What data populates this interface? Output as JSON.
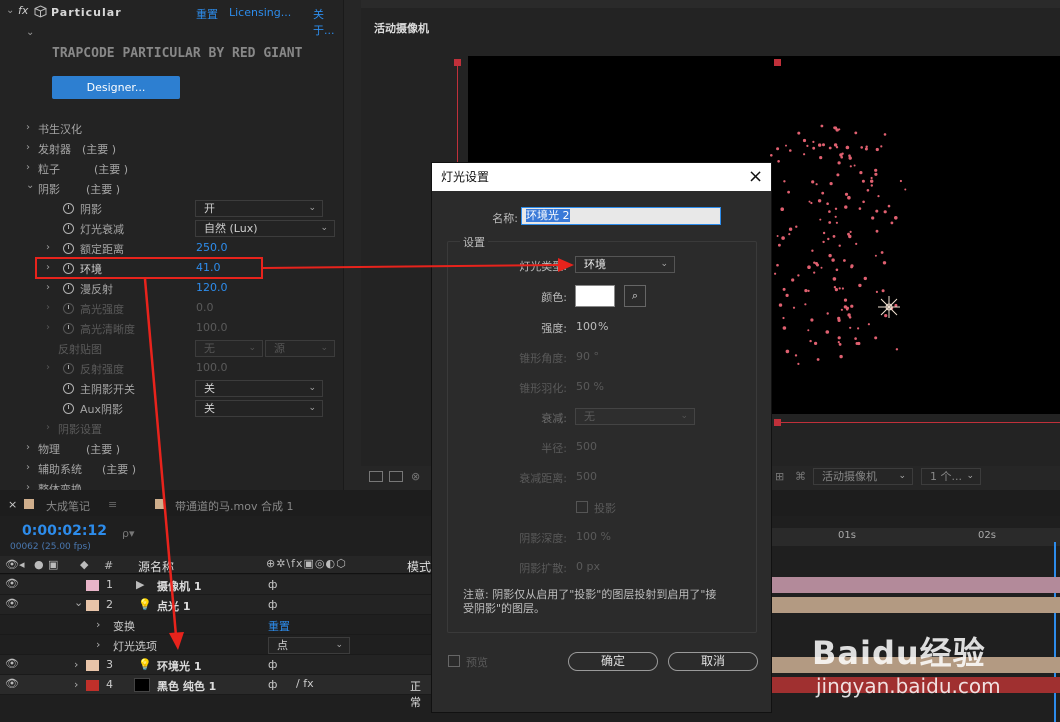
{
  "effects": {
    "fx_name": "Particular",
    "reset": "重置",
    "licensing": "Licensing...",
    "about": "关于...",
    "brand": "TRAPCODE PARTICULAR BY RED GIANT",
    "designer_btn": "Designer...",
    "groups": [
      {
        "label": "书生汉化",
        "tag": ""
      },
      {
        "label": "发射器",
        "tag": "(主要 )"
      },
      {
        "label": "粒子",
        "tag": "(主要 )"
      },
      {
        "label": "阴影",
        "tag": "(主要 )"
      }
    ],
    "params": {
      "shadow": {
        "label": "阴影",
        "value": "开"
      },
      "light_falloff": {
        "label": "灯光衰减",
        "value": "自然 (Lux)"
      },
      "nominal_distance": {
        "label": "额定距离",
        "value": "250.0"
      },
      "ambient": {
        "label": "环境",
        "value": "41.0"
      },
      "diffuse": {
        "label": "漫反射",
        "value": "120.0"
      },
      "specular": {
        "label": "高光强度",
        "value": "0.0"
      },
      "specular_sharp": {
        "label": "高光清晰度",
        "value": "100.0"
      },
      "reflection_map": {
        "label": "反射贴图",
        "value": "无",
        "value2": "源"
      },
      "reflection_strength": {
        "label": "反射强度",
        "value": "100.0"
      },
      "main_shadow": {
        "label": "主阴影开关",
        "value": "关"
      },
      "aux_shadow": {
        "label": "Aux阴影",
        "value": "关"
      },
      "shadow_settings": {
        "label": "阴影设置"
      }
    },
    "groups2": [
      {
        "label": "物理",
        "tag": "(主要 )"
      },
      {
        "label": "辅助系统",
        "tag": "(主要 )"
      },
      {
        "label": "整体变换",
        "tag": ""
      }
    ]
  },
  "comp_viewer": {
    "camera_label": "活动摄像机",
    "footer_camera": "活动摄像机",
    "footer_view": "1 个..."
  },
  "timeline": {
    "tab1": "大成笔记",
    "tab2": "带通道的马.mov 合成 1",
    "timecode": "0:00:02:12",
    "frame_info": "00062 (25.00 fps)",
    "search_placeholder": "ρ▾",
    "col_num": "#",
    "col_source": "源名称",
    "col_mode": "模式",
    "ruler": [
      "01s",
      "02s"
    ],
    "layers": [
      {
        "num": "1",
        "name": "摄像机 1",
        "color": "#e8b4c8"
      },
      {
        "num": "2",
        "name": "点光 1",
        "color": "#e8c4a8"
      },
      {
        "num": "3",
        "name": "环境光 1",
        "color": "#e8c4a8"
      },
      {
        "num": "4",
        "name": "黑色 纯色 1",
        "color": "#c0302a",
        "mode": "正常"
      }
    ],
    "transform": {
      "label": "变换",
      "value": "重置"
    },
    "light_options": {
      "label": "灯光选项",
      "value": "点"
    },
    "layer4_mode_value": "无"
  },
  "dialog": {
    "title": "灯光设置",
    "name_label": "名称:",
    "name_value": "环境光 2",
    "settings_label": "设置",
    "light_type_label": "灯光类型:",
    "light_type_value": "环境",
    "color_label": "颜色:",
    "intensity_label": "强度:",
    "intensity_value": "100",
    "intensity_unit": "%",
    "cone_angle_label": "锥形角度:",
    "cone_angle_value": "90 °",
    "cone_feather_label": "锥形羽化:",
    "cone_feather_value": "50 %",
    "falloff_label": "衰减:",
    "falloff_value": "无",
    "radius_label": "半径:",
    "radius_value": "500",
    "falloff_dist_label": "衰减距离:",
    "falloff_dist_value": "500",
    "cast_shadow_label": "投影",
    "shadow_darkness_label": "阴影深度:",
    "shadow_darkness_value": "100 %",
    "shadow_diffusion_label": "阴影扩散:",
    "shadow_diffusion_value": "0 px",
    "note": "注意: 阴影仅从启用了\"投影\"的图层投射到启用了\"接受阴影\"的图层。",
    "preview_label": "预览",
    "ok": "确定",
    "cancel": "取消"
  },
  "watermark": {
    "brand": "Baidu经验",
    "url": "jingyan.baidu.com"
  },
  "colors": {
    "accent_blue": "#2d8ceb",
    "annotation_red": "#e8231c",
    "particle": "#e06070"
  }
}
